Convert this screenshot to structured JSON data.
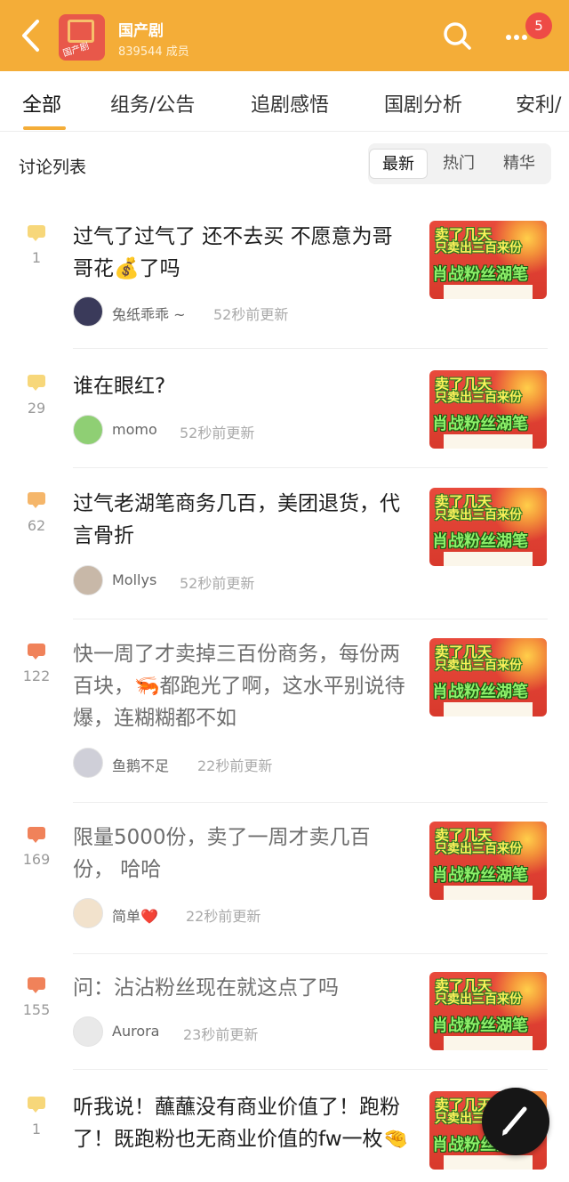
{
  "header": {
    "group_name": "国产剧",
    "member_count": "839544 成员",
    "avatar_tag": "国产剧",
    "badge_count": "5"
  },
  "tabs": [
    {
      "label": "全部",
      "active": true
    },
    {
      "label": "组务/公告"
    },
    {
      "label": "追剧感悟"
    },
    {
      "label": "国剧分析"
    },
    {
      "label": "安利/"
    }
  ],
  "list": {
    "title": "讨论列表",
    "filters": [
      {
        "label": "最新",
        "active": true
      },
      {
        "label": "热门"
      },
      {
        "label": "精华"
      }
    ]
  },
  "thumbnail_text": {
    "line1": "卖了几天",
    "line2": "只卖出三百来份",
    "line3": "肖战粉丝湖笔"
  },
  "posts": [
    {
      "title": "过气了过气了 还不去买 不愿意为哥哥花💰了吗",
      "count": "1",
      "author": "兔纸乖乖 ~",
      "time": "52秒前更新",
      "bubble_color": "#f7d77a"
    },
    {
      "title": "谁在眼红?",
      "count": "29",
      "author": "momo",
      "time": "52秒前更新",
      "bubble_color": "#f7d77a"
    },
    {
      "title": "过气老湖笔商务几百，美团退货，代言骨折",
      "count": "62",
      "author": "Mollys",
      "time": "52秒前更新",
      "bubble_color": "#f5b66a"
    },
    {
      "title": "快一周了才卖掉三百份商务，每份两百块，🦐都跑光了啊，这水平别说待爆，连糊糊都不如",
      "count": "122",
      "author": "鱼鹅不足",
      "time": "22秒前更新",
      "bubble_color": "#f0825a"
    },
    {
      "title": "限量5000份，卖了一周才卖几百份， 哈哈",
      "count": "169",
      "author": "简单❤️",
      "time": "22秒前更新",
      "bubble_color": "#f0825a"
    },
    {
      "title": "问：沾沾粉丝现在就这点了吗",
      "count": "155",
      "author": "Aurora",
      "time": "23秒前更新",
      "bubble_color": "#f0825a"
    },
    {
      "title": "听我说！蘸蘸没有商业价值了！跑粉了！既跑粉也无商业价值的fw一枚🤏",
      "count": "1",
      "author": "",
      "time": "",
      "bubble_color": "#f7d77a"
    }
  ],
  "colors": {
    "header_bg": "#f4ad38",
    "badge": "#ee4b46"
  }
}
